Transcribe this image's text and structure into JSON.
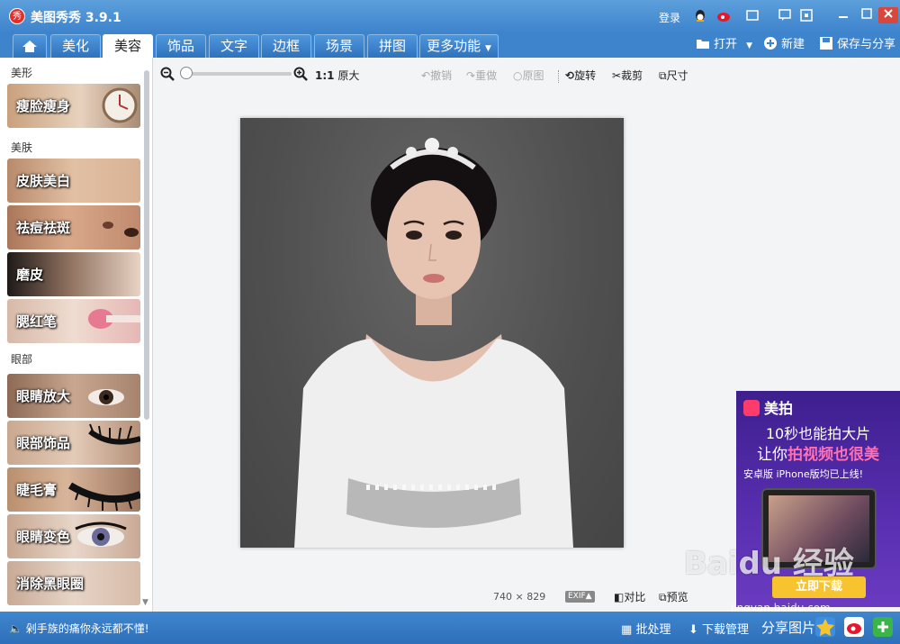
{
  "app": {
    "title": "美图秀秀 3.9.1",
    "logo_char": "秀"
  },
  "titlebar": {
    "login": "登录"
  },
  "tabs": [
    {
      "label": "",
      "icon": "home-icon"
    },
    {
      "label": "美化"
    },
    {
      "label": "美容",
      "active": true
    },
    {
      "label": "饰品"
    },
    {
      "label": "文字"
    },
    {
      "label": "边框"
    },
    {
      "label": "场景"
    },
    {
      "label": "拼图"
    },
    {
      "label": "更多功能"
    }
  ],
  "actions": {
    "open": "打开",
    "new": "新建",
    "save_share": "保存与分享"
  },
  "sidebar": {
    "sections": [
      {
        "title": "美形",
        "items": [
          {
            "label": "瘦脸瘦身"
          }
        ]
      },
      {
        "title": "美肤",
        "items": [
          {
            "label": "皮肤美白"
          },
          {
            "label": "祛痘祛斑"
          },
          {
            "label": "磨皮"
          },
          {
            "label": "腮红笔"
          }
        ]
      },
      {
        "title": "眼部",
        "items": [
          {
            "label": "眼睛放大"
          },
          {
            "label": "眼部饰品"
          },
          {
            "label": "睫毛膏"
          },
          {
            "label": "眼睛变色"
          },
          {
            "label": "消除黑眼圈"
          }
        ]
      }
    ]
  },
  "toolbar": {
    "zoom_ratio": "1:1",
    "original_size": "原大",
    "undo": "撤销",
    "redo": "重做",
    "original_image": "原图",
    "rotate": "旋转",
    "crop": "裁剪",
    "size": "尺寸"
  },
  "image_info": {
    "width": "740",
    "times": "×",
    "height": "829",
    "exif": "EXIF▲",
    "compare": "对比",
    "preview": "预览"
  },
  "ad": {
    "brand": "美拍",
    "line1": "10秒也能拍大片",
    "line2_prefix": "让你",
    "line2_highlight": "拍视频也很美",
    "line3": "安卓版  iPhone版均已上线!",
    "button": "立即下载"
  },
  "watermark": {
    "main": "Baidu 经验",
    "sub": "jingyan.baidu.com"
  },
  "statusbar": {
    "message": "剁手族的痛你永远都不懂!",
    "batch": "批处理",
    "downloads": "下载管理",
    "share_label": "分享图片"
  },
  "colors": {
    "accent": "#3e84cd",
    "active_tab": "#ffffff",
    "ad_highlight": "#ff6fb3",
    "ad_button": "#f7c430"
  }
}
